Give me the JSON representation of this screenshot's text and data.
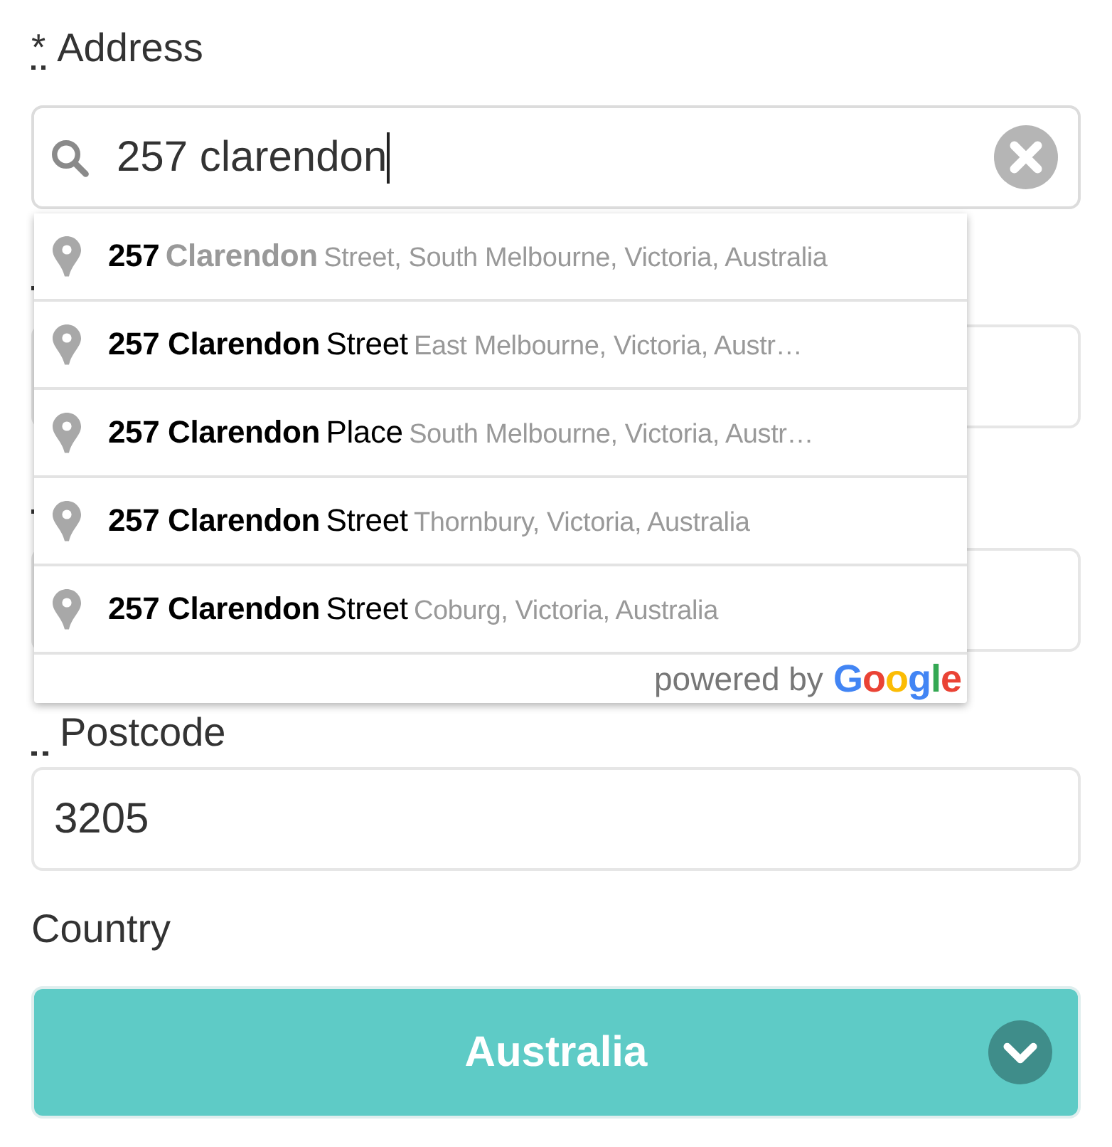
{
  "address": {
    "label": "Address",
    "required": true,
    "required_mark": "*",
    "value": "257 clarendon",
    "focused": true
  },
  "hidden_fields": [
    {
      "required": true
    },
    {
      "required": true
    }
  ],
  "suggestions": [
    {
      "segments": [
        {
          "text": "257",
          "bold": true,
          "muted": false
        },
        {
          "text": "Clarendon",
          "bold": true,
          "muted": true
        },
        {
          "text": "Street, South Melbourne, Victoria, Australia",
          "bold": false,
          "muted": true
        }
      ]
    },
    {
      "segments": [
        {
          "text": "257 Clarendon",
          "bold": true,
          "muted": false
        },
        {
          "text": "Street",
          "bold": false,
          "muted": false
        },
        {
          "text": "East Melbourne, Victoria, Austr…",
          "bold": false,
          "muted": true
        }
      ]
    },
    {
      "segments": [
        {
          "text": "257 Clarendon",
          "bold": true,
          "muted": false
        },
        {
          "text": "Place",
          "bold": false,
          "muted": false
        },
        {
          "text": "South Melbourne, Victoria, Austr…",
          "bold": false,
          "muted": true
        }
      ]
    },
    {
      "segments": [
        {
          "text": "257 Clarendon",
          "bold": true,
          "muted": false
        },
        {
          "text": "Street",
          "bold": false,
          "muted": false
        },
        {
          "text": "Thornbury, Victoria, Australia",
          "bold": false,
          "muted": true
        }
      ]
    },
    {
      "segments": [
        {
          "text": "257 Clarendon",
          "bold": true,
          "muted": false
        },
        {
          "text": "Street",
          "bold": false,
          "muted": false
        },
        {
          "text": "Coburg, Victoria, Australia",
          "bold": false,
          "muted": true
        }
      ]
    }
  ],
  "attribution": {
    "prefix": "powered by",
    "brand": [
      {
        "text": "G",
        "color": "#4285f4"
      },
      {
        "text": "o",
        "color": "#ea4335"
      },
      {
        "text": "o",
        "color": "#fbbc05"
      },
      {
        "text": "g",
        "color": "#4285f4"
      },
      {
        "text": "l",
        "color": "#34a853"
      },
      {
        "text": "e",
        "color": "#ea4335"
      }
    ]
  },
  "postcode": {
    "label": "Postcode",
    "required": true,
    "value": "3205"
  },
  "country": {
    "label": "Country",
    "value": "Australia"
  }
}
